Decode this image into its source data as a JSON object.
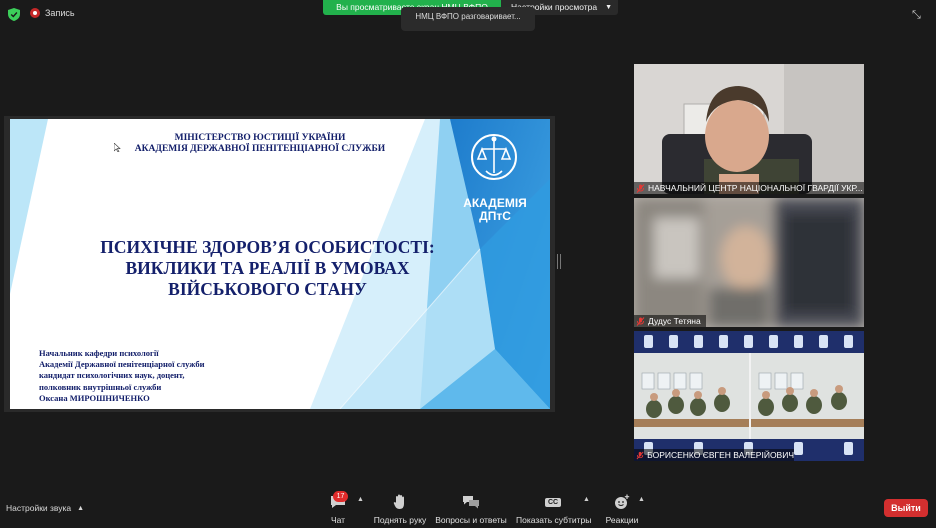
{
  "topbar": {
    "record_label": "Запись",
    "share_banner": "Вы просматриваете экран НМЦ ВФПО",
    "view_settings": "Настройки просмотра",
    "speaking_indicator": "НМЦ ВФПО разговаривает..."
  },
  "slide": {
    "ministry_line1": "МІНІСТЕРСТВО ЮСТИЦІЇ УКРАЇНИ",
    "ministry_line2": "АКАДЕМІЯ ДЕРЖАВНОЇ ПЕНІТЕНЦІАРНОЇ СЛУЖБИ",
    "title_line1": "ПСИХІЧНЕ ЗДОРОВ’Я ОСОБИСТОСТІ:",
    "title_line2": "ВИКЛИКИ ТА РЕАЛІЇ В УМОВАХ",
    "title_line3": "ВІЙСЬКОВОГО СТАНУ",
    "author_line1": "Начальник кафедри психології",
    "author_line2": "Академії Державної пенітенціарної служби",
    "author_line3": "кандидат психологічних наук, доцент,",
    "author_line4": "полковник внутрішньої служби",
    "author_line5": "Оксана МИРОШНИЧЕНКО",
    "academy_line1": "АКАДЕМІЯ",
    "academy_line2": "ДПтС",
    "colors": {
      "navy_text": "#14206b",
      "blue_band": "#2b8fd6",
      "light_blue": "#8fd0f2"
    }
  },
  "participants": [
    {
      "name": "НАВЧАЛЬНИЙ ЦЕНТР НАЦІОНАЛЬНОЇ ГВАРДІЇ УКР...",
      "muted": true
    },
    {
      "name": "Дудус Тетяна",
      "muted": true
    },
    {
      "name": "БОРИСЕНКО ЄВГЕН ВАЛЕРІЙОВИЧ",
      "muted": true
    }
  ],
  "bottombar": {
    "audio_settings": "Настройки звука",
    "chat": "Чат",
    "chat_badge": "17",
    "raise_hand": "Поднять руку",
    "qa": "Вопросы и ответы",
    "captions": "Показать субтитры",
    "captions_icon_text": "CC",
    "reactions": "Реакции",
    "leave": "Выйти"
  }
}
